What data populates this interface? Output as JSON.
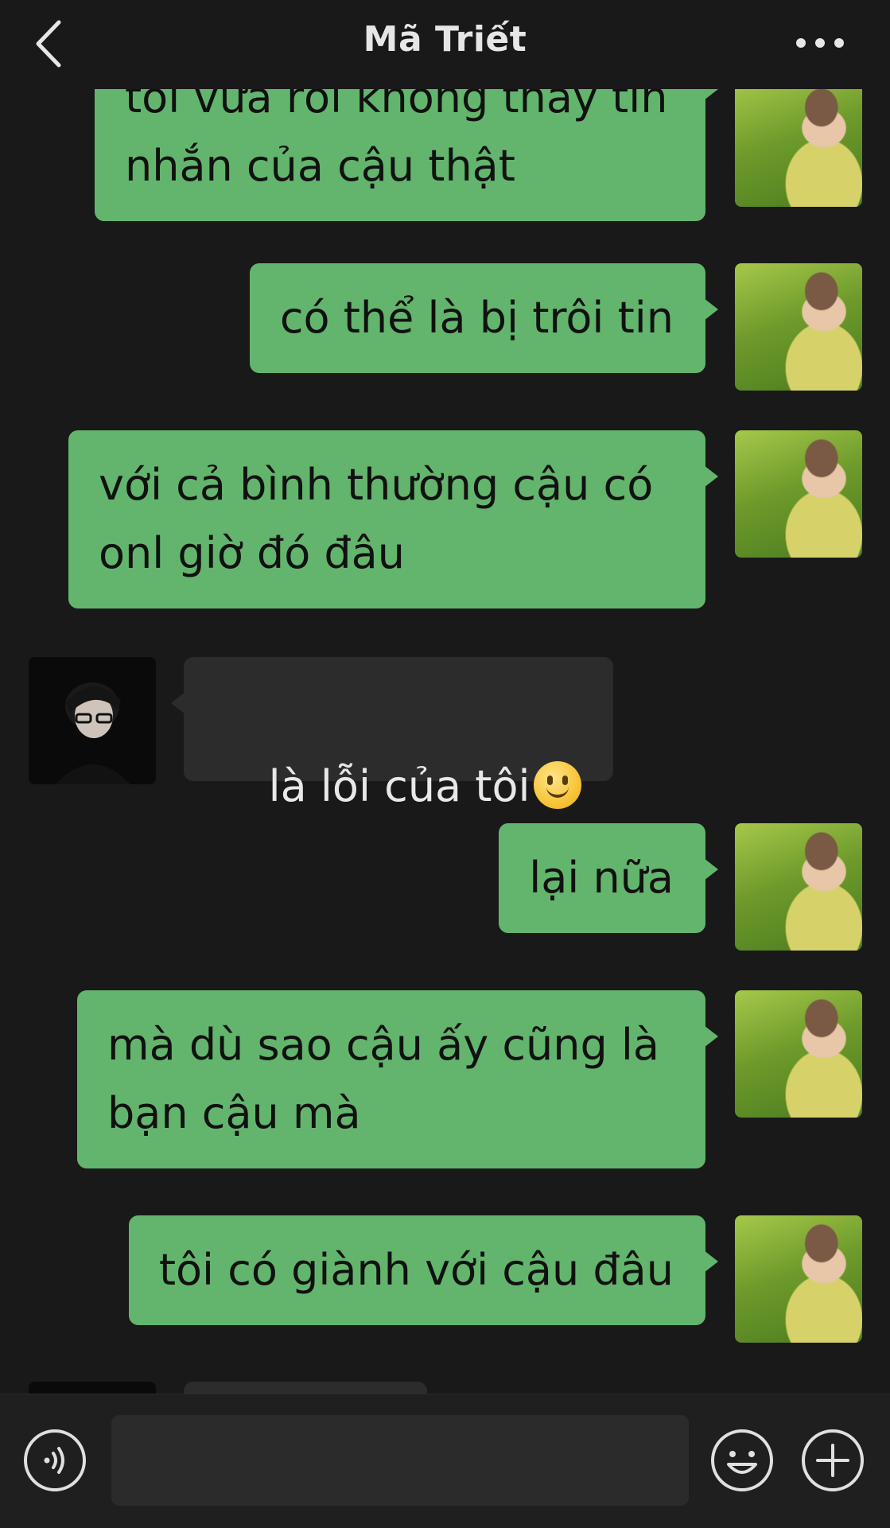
{
  "header": {
    "title": "Mã Triết",
    "back_icon": "chevron-left-icon",
    "more_icon": "more-dots-icon"
  },
  "messages": [
    {
      "side": "me",
      "text": "tôi vừa rồi không thấy tin\nnhắn của cậu thật"
    },
    {
      "side": "me",
      "text": "có thể là bị trôi tin"
    },
    {
      "side": "me",
      "text": "với cả bình thường cậu có\nonl giờ đó đâu"
    },
    {
      "side": "other",
      "text": "là lỗi của tôi",
      "emoji": "slightly-smiling-face"
    },
    {
      "side": "me",
      "text": "lại nữa"
    },
    {
      "side": "me",
      "text": "mà dù sao cậu ấy cũng là\nbạn cậu mà"
    },
    {
      "side": "me",
      "text": "tôi có giành với cậu đâu"
    }
  ],
  "input": {
    "value": "",
    "placeholder": ""
  },
  "colors": {
    "background": "#191919",
    "my_bubble": "#63b56d",
    "other_bubble": "#2c2c2c"
  },
  "icons": {
    "voice": "voice-icon",
    "emoji": "emoji-icon",
    "plus": "plus-icon"
  }
}
